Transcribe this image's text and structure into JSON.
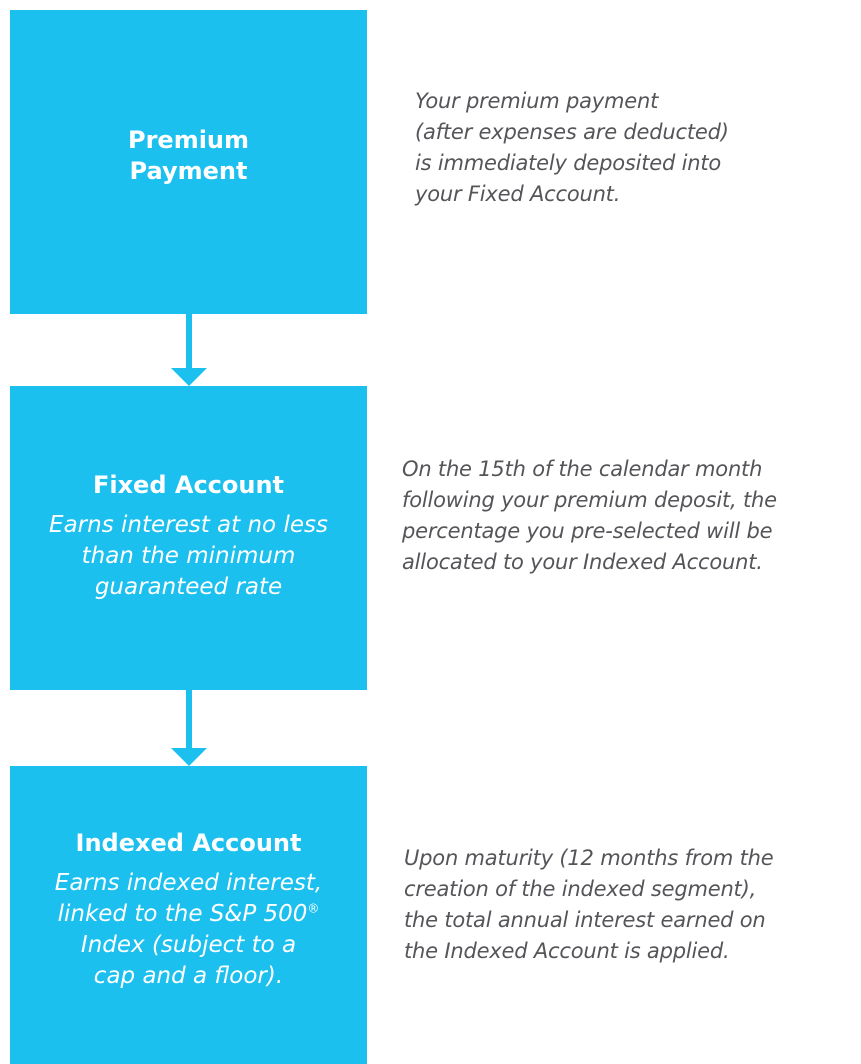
{
  "steps": [
    {
      "title_lines": [
        "Premium",
        "Payment"
      ],
      "description_lines": [
        "Your premium payment",
        "(after expenses are deducted)",
        "is immediately deposited into",
        "your Fixed Account."
      ]
    },
    {
      "title": "Fixed Account",
      "subtitle_lines": [
        "Earns interest at no less",
        "than the minimum",
        "guaranteed rate"
      ],
      "description_lines": [
        "On the 15th of the calendar month",
        "following your premium deposit, the",
        "percentage you pre-selected will be",
        "allocated to your Indexed Account."
      ]
    },
    {
      "title": "Indexed Account",
      "subtitle_lines": [
        "Earns indexed interest,",
        "linked to the S&P 500",
        "Index (subject to a",
        "cap and a floor)."
      ],
      "subtitle_superscript": "®",
      "description_lines": [
        "Upon maturity (12 months from the",
        "creation of the indexed segment),",
        "the total annual interest earned on",
        "the Indexed Account is applied."
      ]
    }
  ],
  "colors": {
    "box_fill": "#1cc0ef",
    "box_text": "#ffffff",
    "description_text": "#555459"
  }
}
